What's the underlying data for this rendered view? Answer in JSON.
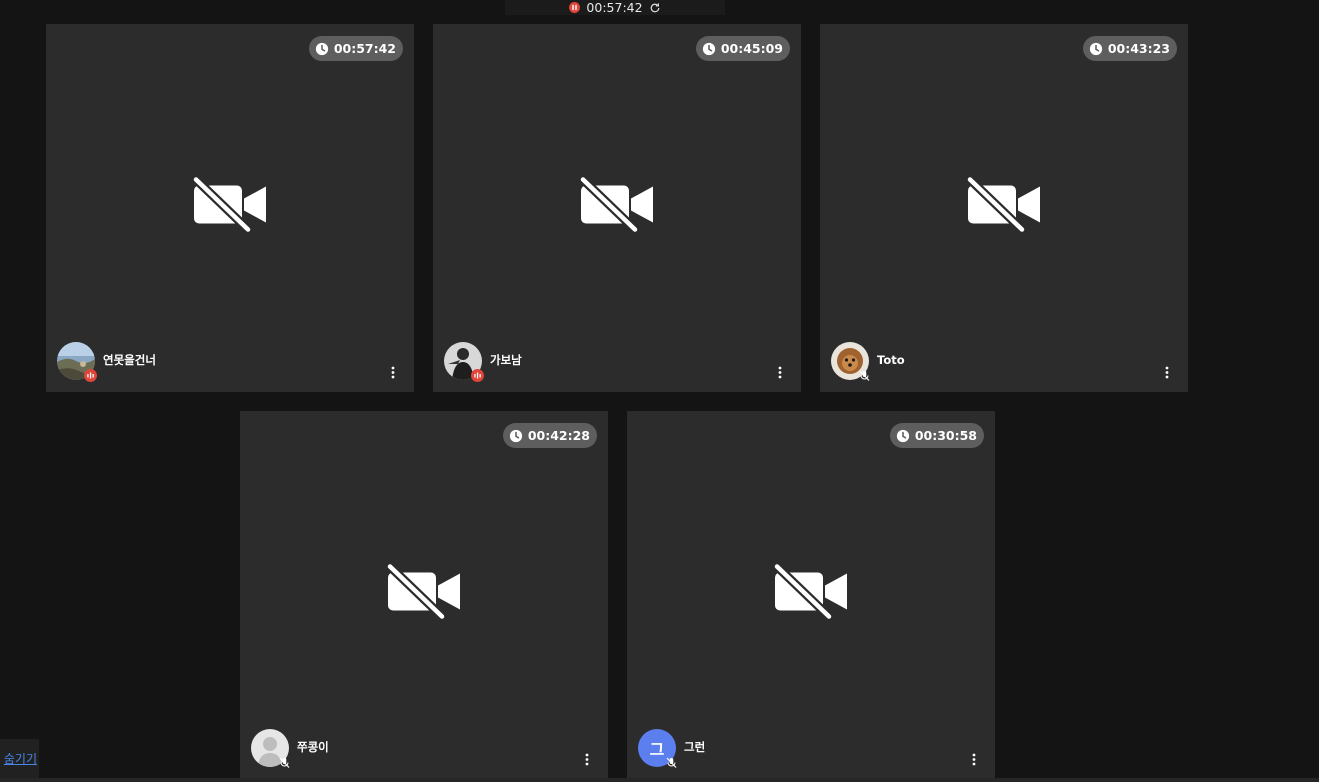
{
  "session": {
    "timer": "00:57:42",
    "recording_color": "#e0453a"
  },
  "tiles": [
    {
      "name": "연못을건너",
      "elapsed": "00:57:42",
      "avatar": "landscape-photo",
      "mic": "speaking"
    },
    {
      "name": "가보남",
      "elapsed": "00:45:09",
      "avatar": "person-photo",
      "mic": "speaking"
    },
    {
      "name": "Toto",
      "elapsed": "00:43:23",
      "avatar": "dog-photo",
      "mic": "muted"
    },
    {
      "name": "쭈콩이",
      "elapsed": "00:42:28",
      "avatar": "default-person",
      "mic": "muted"
    },
    {
      "name": "그런",
      "elapsed": "00:30:58",
      "avatar": "letter",
      "avatar_letter": "그",
      "avatar_color": "#5b7fee",
      "mic": "muted"
    }
  ],
  "footer": {
    "hide_label": "숨기기"
  },
  "colors": {
    "background": "#141414",
    "tile": "#2c2c2c",
    "badge_pill": "#5e5e5e",
    "speaking_badge": "#e0453a",
    "link": "#4a86e8"
  }
}
